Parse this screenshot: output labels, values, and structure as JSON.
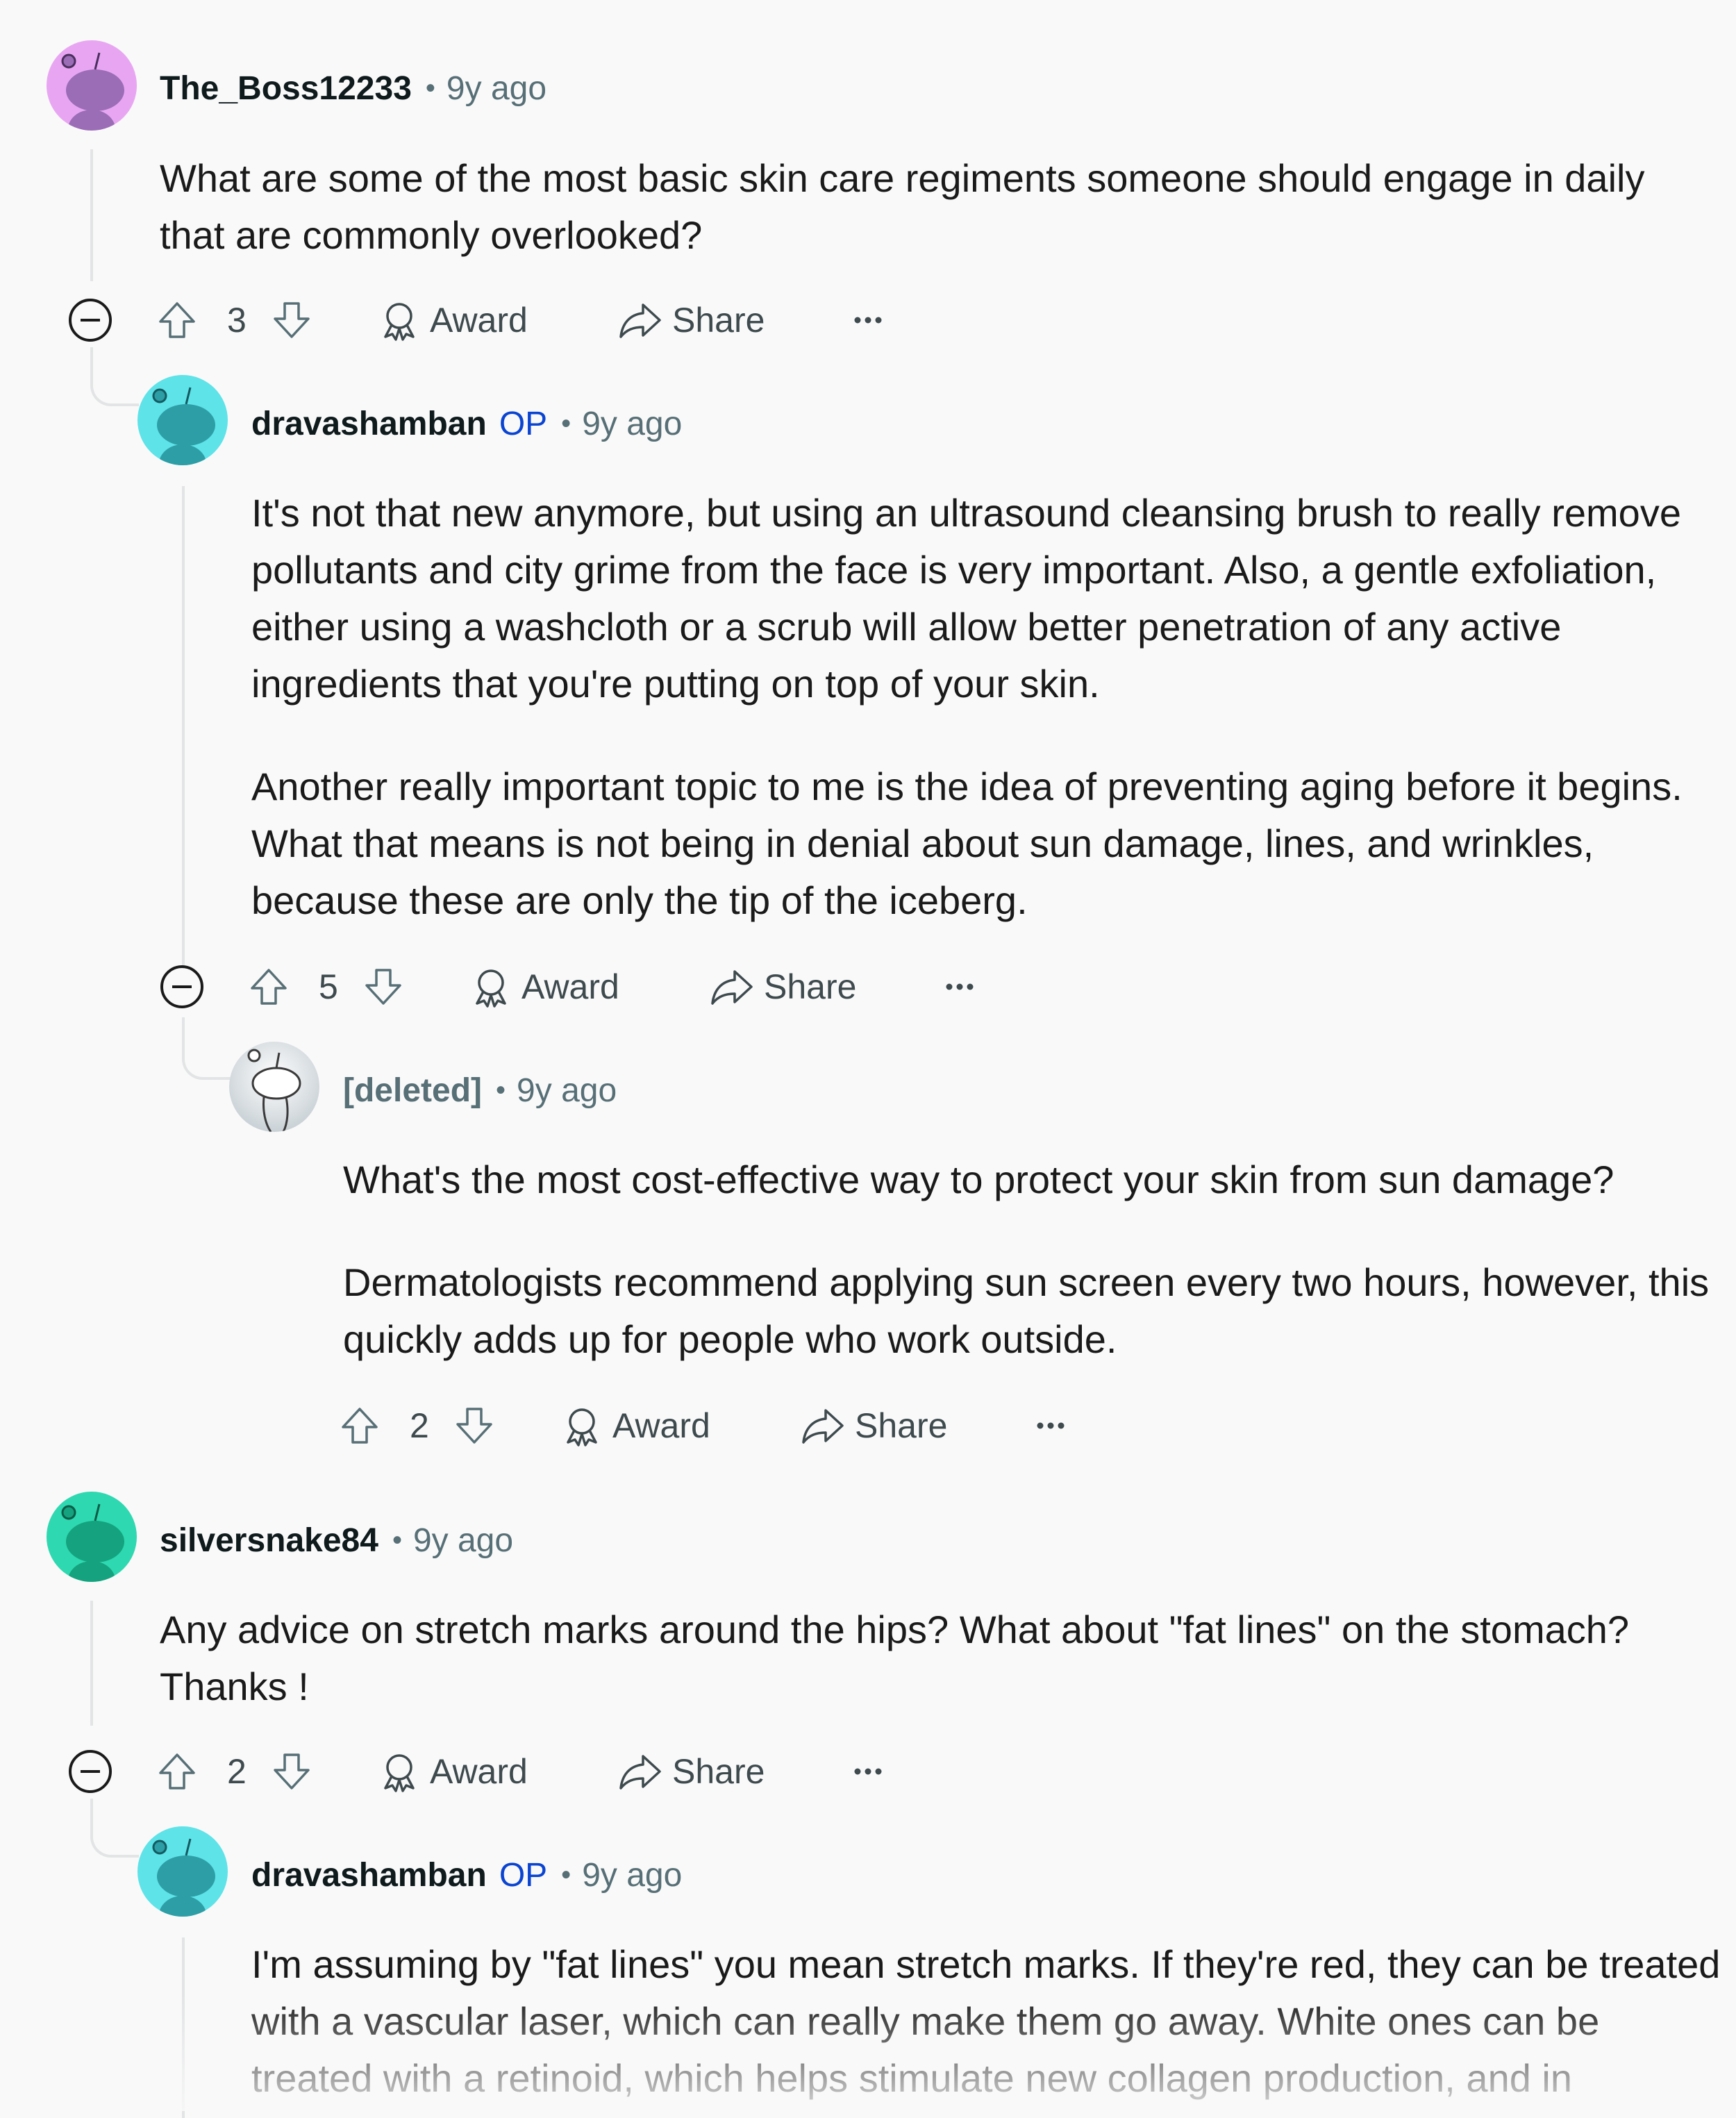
{
  "comments": [
    {
      "id": "c1",
      "author": "The_Boss12233",
      "time": "9y ago",
      "avatar_color": "#e8a6f2",
      "paragraphs": [
        "What are some of the most basic skin care regiments someone should engage in daily that are commonly overlooked?"
      ],
      "votes": "3"
    },
    {
      "id": "c2",
      "author": "dravashamban",
      "op_badge": "OP",
      "time": "9y ago",
      "avatar_color": "#5ee3e8",
      "paragraphs": [
        "It's not that new anymore, but using an ultrasound cleansing brush to really remove pollutants and city grime from the face is very important. Also, a gentle exfoliation, either using a washcloth or a scrub will allow better penetration of any active ingredients that you're putting on top of your skin.",
        "Another really important topic to me is the idea of preventing aging before it begins. What that means is not being in denial about sun damage, lines, and wrinkles, because these are only the tip of the iceberg."
      ],
      "votes": "5"
    },
    {
      "id": "c3",
      "author": "[deleted]",
      "time": "9y ago",
      "avatar_color": "#d9dee0",
      "paragraphs": [
        "What's the most cost-effective way to protect your skin from sun damage?",
        "Dermatologists recommend applying sun screen every two hours, however, this quickly adds up for people who work outside."
      ],
      "votes": "2"
    },
    {
      "id": "c4",
      "author": "silversnake84",
      "time": "9y ago",
      "avatar_color": "#2ed8b0",
      "paragraphs": [
        "Any advice on stretch marks around the hips? What about \"fat lines\" on the stomach? Thanks !"
      ],
      "votes": "2"
    },
    {
      "id": "c5",
      "author": "dravashamban",
      "op_badge": "OP",
      "time": "9y ago",
      "avatar_color": "#5ee3e8",
      "paragraphs": [
        "I'm assuming by \"fat lines\" you mean stretch marks. If they're red, they can be treated with a vascular laser, which can really make them go away. White ones can be treated with a retinoid, which helps stimulate new collagen production, and in"
      ]
    }
  ],
  "actions": {
    "award_label": "Award",
    "share_label": "Share",
    "separator": "•"
  },
  "icons": {
    "upvote": "arrow-up-icon",
    "downvote": "arrow-down-icon",
    "award": "award-icon",
    "share": "share-icon",
    "more": "more-icon",
    "collapse": "collapse-minus-icon",
    "avatar": "snoo-avatar-icon"
  }
}
